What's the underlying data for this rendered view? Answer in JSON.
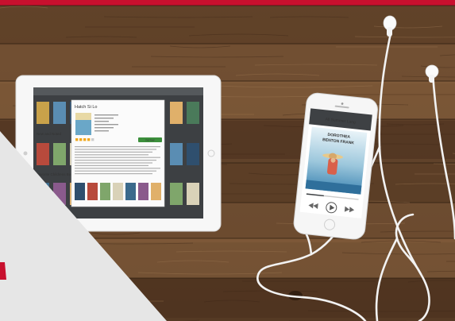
{
  "brand": {
    "accent_color": "#c8102e"
  },
  "scene": {
    "surface": "wooden-table",
    "wood_colors": [
      "#5a3c25",
      "#7a5536",
      "#8c6440",
      "#4a301d"
    ],
    "tablet": {
      "kind": "tablet",
      "color": "#ffffff",
      "screen": {
        "popup_title": "Hatch Si Lo",
        "shelf_labels": [
          "New and Noted",
          "Favorite Childrens Books"
        ],
        "button_label": "borrow",
        "rating_stars": 4
      }
    },
    "phone": {
      "kind": "smartphone",
      "color": "#f4f4f4",
      "screen": {
        "header_text": "All Summer Long",
        "cover_text": [
          "DOROTHEA",
          "BENTON FRANK"
        ],
        "controls": [
          "rewind-icon",
          "play-icon",
          "forward-icon"
        ]
      }
    },
    "earphones": {
      "kind": "earbuds",
      "color": "#ffffff"
    }
  },
  "overlay": {
    "color": "#e6e6e6",
    "accent_fragment_color": "#c8102e"
  }
}
